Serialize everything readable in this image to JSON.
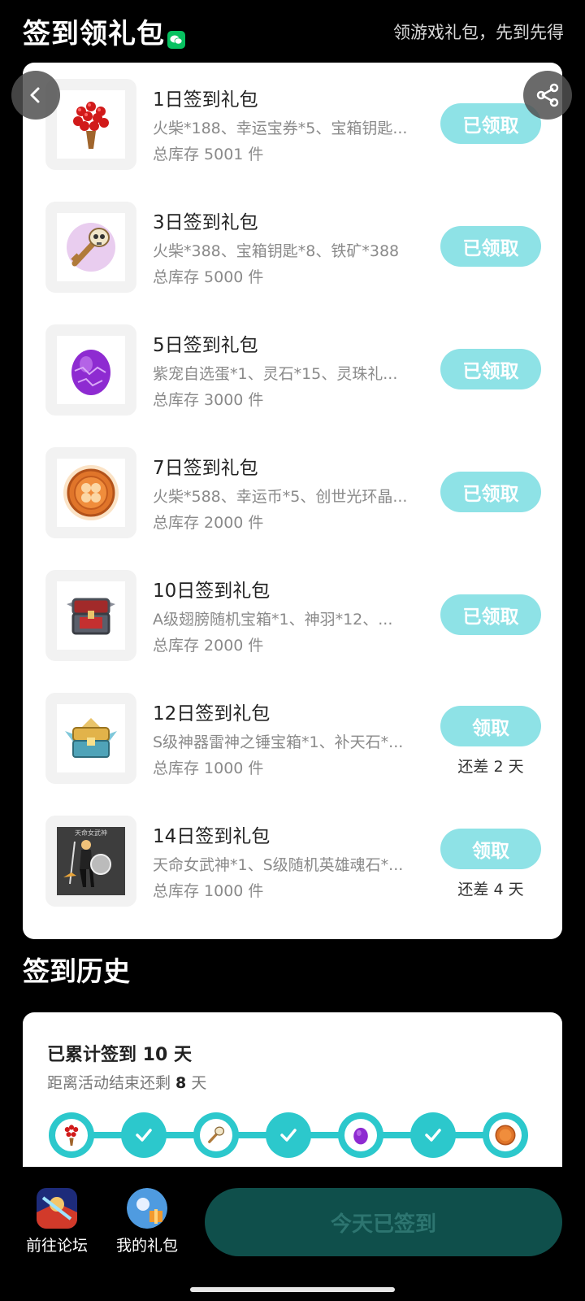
{
  "header": {
    "title": "签到领礼包",
    "slogan": "领游戏礼包，先到先得"
  },
  "colors": {
    "accent": "#2cc8cc",
    "claimed_button": "#8ee2e6",
    "checkin_button_bg": "#0f4f4b",
    "wechat_green": "#07c160"
  },
  "gifts": [
    {
      "title": "1日签到礼包",
      "desc": "火柴*188、幸运宝券*5、宝箱钥匙...",
      "stock": "总库存 5001 件",
      "button": "已领取",
      "remain": "",
      "icon": "red-flower-bouquet-icon"
    },
    {
      "title": "3日签到礼包",
      "desc": "火柴*388、宝箱钥匙*8、铁矿*388",
      "stock": "总库存 5000 件",
      "button": "已领取",
      "remain": "",
      "icon": "skull-key-icon"
    },
    {
      "title": "5日签到礼包",
      "desc": "紫宠自选蛋*1、灵石*15、灵珠礼...",
      "stock": "总库存 3000 件",
      "button": "已领取",
      "remain": "",
      "icon": "purple-egg-icon"
    },
    {
      "title": "7日签到礼包",
      "desc": "火柴*588、幸运币*5、创世光环晶...",
      "stock": "总库存 2000 件",
      "button": "已领取",
      "remain": "",
      "icon": "lucky-coin-icon"
    },
    {
      "title": "10日签到礼包",
      "desc": "A级翅膀随机宝箱*1、神羽*12、...",
      "stock": "总库存 2000 件",
      "button": "已领取",
      "remain": "",
      "icon": "treasure-chest-icon"
    },
    {
      "title": "12日签到礼包",
      "desc": "S级神器雷神之锤宝箱*1、补天石*...",
      "stock": "总库存 1000 件",
      "button": "领取",
      "remain": "还差 2 天",
      "icon": "winged-chest-icon"
    },
    {
      "title": "14日签到礼包",
      "desc": "天命女武神*1、S级随机英雄魂石*...",
      "stock": "总库存 1000 件",
      "button": "领取",
      "remain": "还差 4 天",
      "icon": "valkyrie-hero-icon",
      "thumb_caption": "天命女武神"
    }
  ],
  "history": {
    "section_title": "签到历史",
    "total_prefix": "已累计签到 ",
    "total_days": "10",
    "total_suffix": " 天",
    "remain_prefix": "距离活动结束还剩 ",
    "remain_days": "8",
    "remain_suffix": " 天",
    "timeline": [
      "red-flower-bouquet-icon",
      "check-icon",
      "skull-key-icon",
      "check-icon",
      "purple-egg-icon",
      "check-icon",
      "lucky-coin-icon"
    ]
  },
  "bottom": {
    "forum_label": "前往论坛",
    "mygift_label": "我的礼包",
    "checkin_label": "今天已签到"
  }
}
